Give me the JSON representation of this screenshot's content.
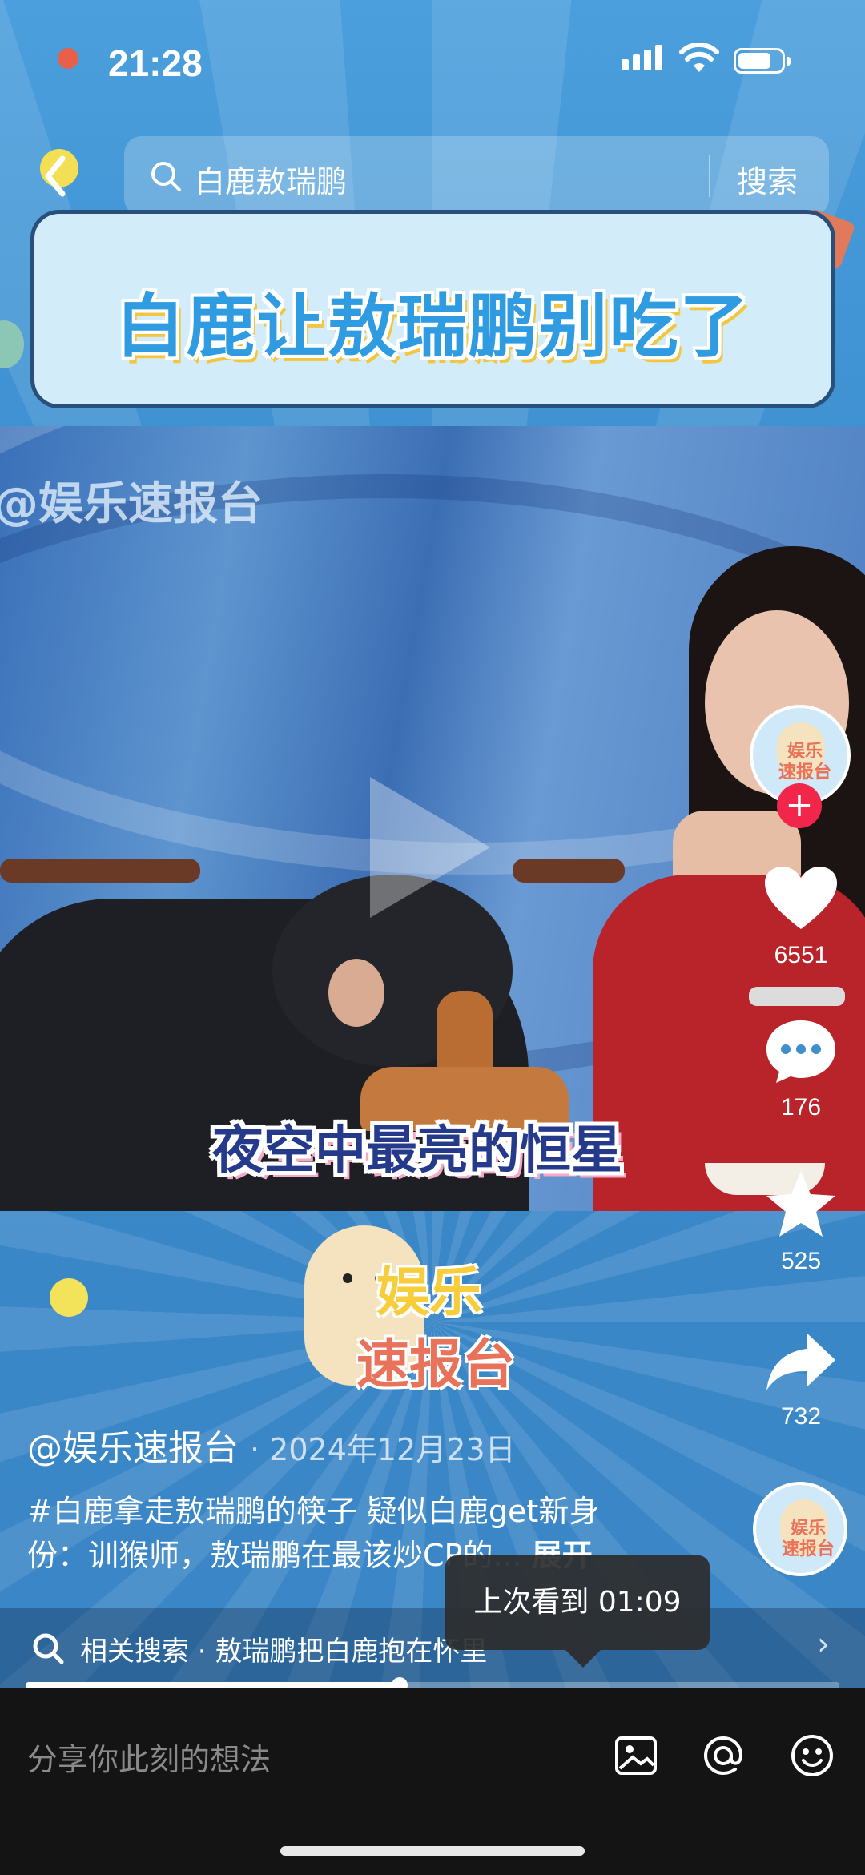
{
  "status_bar": {
    "time": "21:28"
  },
  "nav": {
    "search_query": "白鹿敖瑞鹏",
    "search_button": "搜索"
  },
  "banner": {
    "title": "白鹿让敖瑞鹏别吃了"
  },
  "video": {
    "watermark": "@娱乐速报台",
    "caption": "夜空中最亮的恒星",
    "logo_line1": "娱乐",
    "logo_line2": "速报台"
  },
  "rail": {
    "avatar_text": "娱乐\n速报台",
    "likes": "6551",
    "comments": "176",
    "favorites": "525",
    "shares": "732"
  },
  "post": {
    "author": "@娱乐速报台",
    "date": "2024年12月23日",
    "hashtag": "#白鹿拿走敖瑞鹏的筷子",
    "text": " 疑似白鹿get新身份：训猴师，敖瑞鹏在最该炒CP的...",
    "expand": "展开"
  },
  "tooltip": {
    "text": "上次看到 01:09"
  },
  "related": {
    "label": "相关搜索 · 敖瑞鹏把白鹿抱在怀里"
  },
  "progress": {
    "fraction": 0.46
  },
  "comment": {
    "placeholder": "分享你此刻的想法"
  },
  "icons": [
    "back-icon",
    "search-icon",
    "heart-icon",
    "comment-icon",
    "star-icon",
    "share-icon",
    "image-icon",
    "at-icon",
    "emoji-icon"
  ]
}
